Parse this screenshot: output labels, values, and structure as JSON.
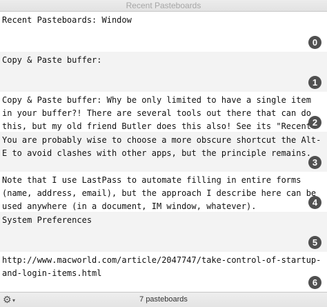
{
  "window": {
    "title": "Recent Pasteboards"
  },
  "pasteboards": [
    {
      "text": "Recent Pasteboards: Window",
      "index": "0"
    },
    {
      "text": "Copy & Paste buffer:",
      "index": "1"
    },
    {
      "text": "Copy & Paste buffer: Why be only limited to have a single item in your buffer?! There are several tools out there that can do this, but my old friend Butler does this also! See its \"Recent",
      "index": "2"
    },
    {
      "text": "You are probably wise to choose a more obscure shortcut the Alt-E to avoid clashes with other apps, but the principle remains.",
      "index": "3"
    },
    {
      "text": "Note that I use LastPass to automate filling in entire forms (name, address, email), but the approach I describe here can be used anywhere (in a document, IM window, whatever).",
      "index": "4"
    },
    {
      "text": "System Preferences",
      "index": "5"
    },
    {
      "text": "http://www.macworld.com/article/2047747/take-control-of-startup-and-login-items.html",
      "index": "6"
    }
  ],
  "footer": {
    "gear_icon": "gear-icon",
    "status": "7 pasteboards"
  }
}
